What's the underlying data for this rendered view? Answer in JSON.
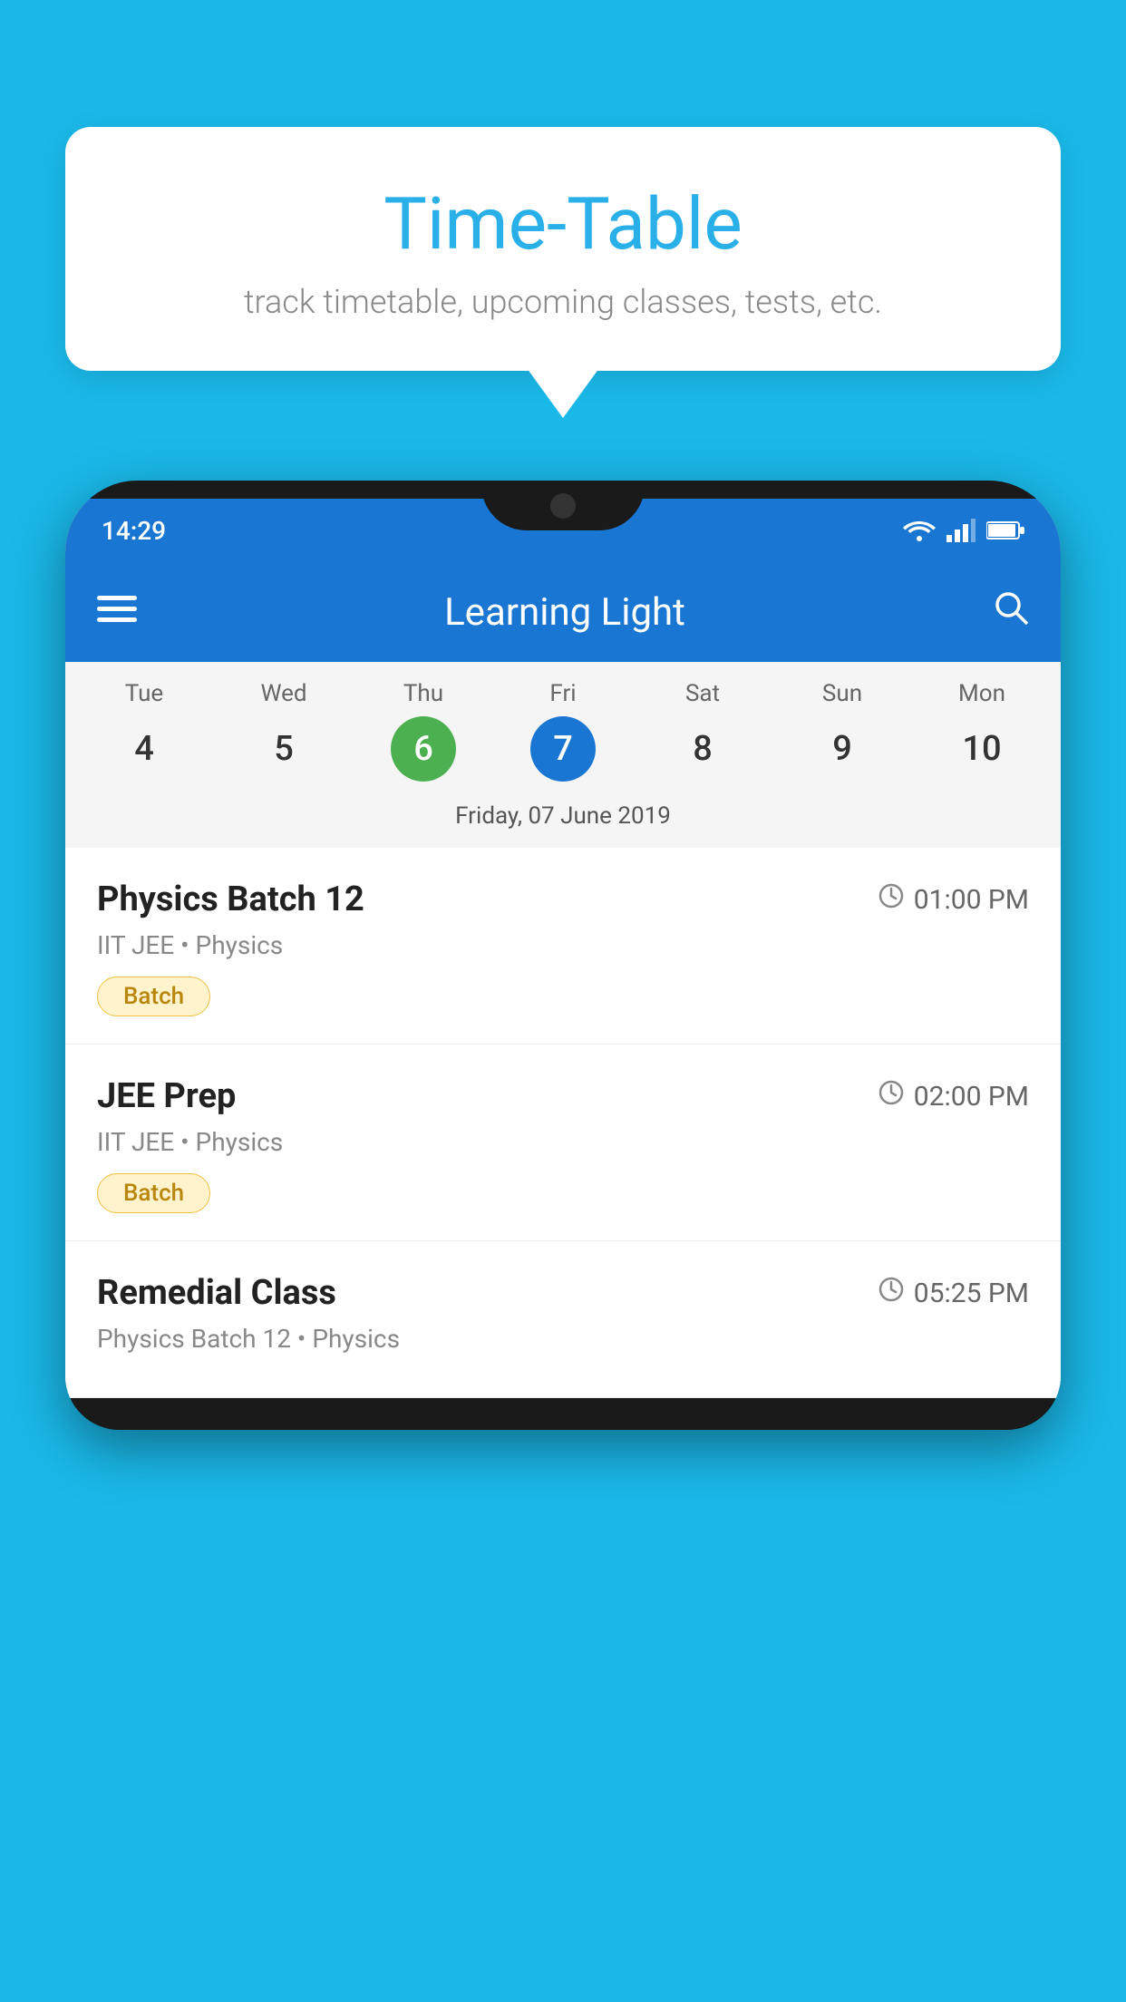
{
  "background_color": "#1ab8e8",
  "speech_bubble": {
    "title": "Time-Table",
    "subtitle": "track timetable, upcoming classes, tests, etc."
  },
  "phone": {
    "status_bar": {
      "time": "14:29"
    },
    "app_bar": {
      "title": "Learning Light"
    },
    "calendar": {
      "days_of_week": [
        "Tue",
        "Wed",
        "Thu",
        "Fri",
        "Sat",
        "Sun",
        "Mon"
      ],
      "dates": [
        "4",
        "5",
        "6",
        "7",
        "8",
        "9",
        "10"
      ],
      "today_index": 2,
      "selected_index": 3,
      "selected_label": "Friday, 07 June 2019"
    },
    "schedule": [
      {
        "title": "Physics Batch 12",
        "time": "01:00 PM",
        "subtitle": "IIT JEE • Physics",
        "tag": "Batch"
      },
      {
        "title": "JEE Prep",
        "time": "02:00 PM",
        "subtitle": "IIT JEE • Physics",
        "tag": "Batch"
      },
      {
        "title": "Remedial Class",
        "time": "05:25 PM",
        "subtitle": "Physics Batch 12 • Physics",
        "tag": null
      }
    ]
  }
}
